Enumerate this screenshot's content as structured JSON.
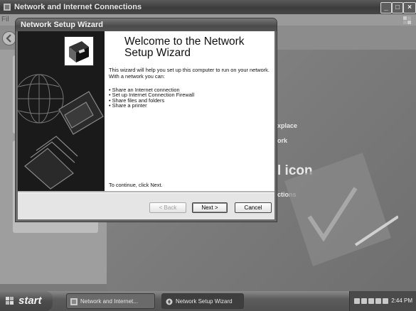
{
  "background_window": {
    "title": "Network and Internet Connections",
    "menu_file": "Fil",
    "content_texts": [
      "xplace",
      "ork",
      "l icon",
      "ctions"
    ]
  },
  "wizard": {
    "title": "Network Setup Wizard",
    "heading": "Welcome to the Network Setup Wizard",
    "intro": "This wizard will help you set up this computer to run on your network. With a network you can:",
    "features": [
      "Share an Internet connection",
      "Set up Internet Connection Firewall",
      "Share files and folders",
      "Share a printer"
    ],
    "continue_text": "To continue, click Next.",
    "buttons": {
      "back": "< Back",
      "next": "Next >",
      "cancel": "Cancel"
    }
  },
  "taskbar": {
    "start_label": "start",
    "items": [
      {
        "label": "Network and Internet..."
      },
      {
        "label": "Network Setup Wizard"
      }
    ],
    "clock": "2:44 PM"
  },
  "icons": [
    "window-app-icon",
    "minimize-icon",
    "maximize-icon",
    "close-icon",
    "back-arrow-icon",
    "windows-logo-icon",
    "wizard-network-icon",
    "globe-icon",
    "printer-icon",
    "folder-icon",
    "start-flag-icon",
    "tray-icons"
  ]
}
